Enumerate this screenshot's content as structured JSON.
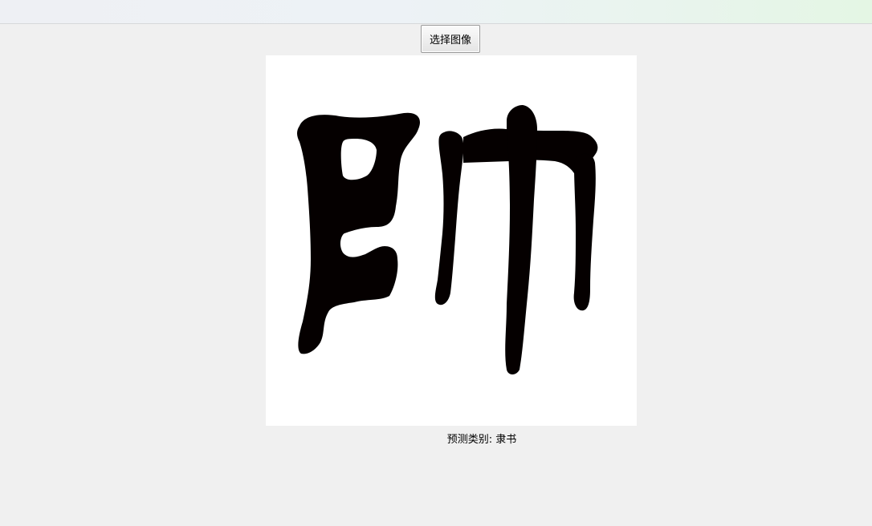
{
  "window": {
    "title": ""
  },
  "toolbar": {
    "select_image_label": "选择图像"
  },
  "image": {
    "depicted_character": "師"
  },
  "result": {
    "label": "预测类别:",
    "value": "隶书"
  },
  "colors": {
    "background": "#f0f0f0",
    "panel": "#ffffff",
    "ink": "#050000"
  }
}
